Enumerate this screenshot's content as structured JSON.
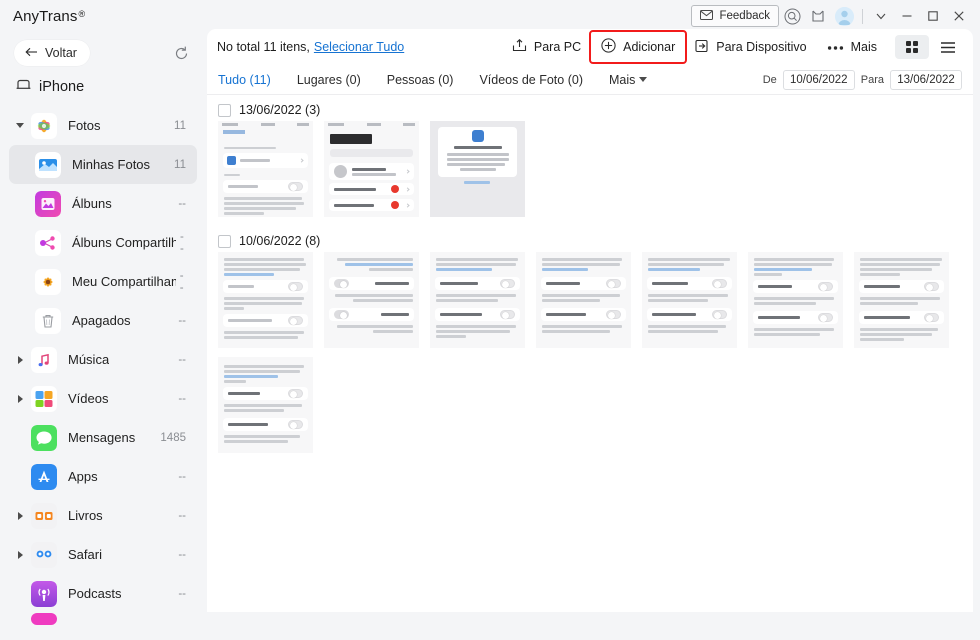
{
  "titlebar": {
    "brand": "AnyTrans",
    "registered": "®",
    "feedback_label": "Feedback",
    "icons": [
      "search-icon",
      "gift-icon",
      "account-avatar"
    ],
    "window_controls": [
      "chevron-down-icon",
      "minimize-icon",
      "maximize-icon",
      "close-icon"
    ]
  },
  "sidebar": {
    "back_label": "Voltar",
    "refresh_name": "refresh-icon",
    "device_name": "iPhone",
    "items": [
      {
        "label": "Fotos",
        "count": "11",
        "level": 1,
        "twisty": "down",
        "selected": false,
        "icon": "photos-icon"
      },
      {
        "label": "Minhas Fotos",
        "count": "11",
        "level": 2,
        "twisty": "none",
        "selected": true,
        "icon": "my-photos-icon"
      },
      {
        "label": "Álbuns",
        "count": "--",
        "level": 2,
        "twisty": "none",
        "selected": false,
        "icon": "albums-icon"
      },
      {
        "label": "Álbuns Compartilhad...",
        "count": "--",
        "level": 2,
        "twisty": "none",
        "selected": false,
        "icon": "shared-albums-icon"
      },
      {
        "label": "Meu Compartilhame...",
        "count": "--",
        "level": 2,
        "twisty": "none",
        "selected": false,
        "icon": "my-sharing-icon"
      },
      {
        "label": "Apagados",
        "count": "--",
        "level": 2,
        "twisty": "none",
        "selected": false,
        "icon": "trash-icon"
      },
      {
        "label": "Música",
        "count": "--",
        "level": 1,
        "twisty": "right",
        "selected": false,
        "icon": "music-icon"
      },
      {
        "label": "Vídeos",
        "count": "--",
        "level": 1,
        "twisty": "right",
        "selected": false,
        "icon": "videos-icon"
      },
      {
        "label": "Mensagens",
        "count": "1485",
        "level": 1,
        "twisty": "none",
        "selected": false,
        "icon": "messages-icon"
      },
      {
        "label": "Apps",
        "count": "--",
        "level": 1,
        "twisty": "none",
        "selected": false,
        "icon": "appstore-icon"
      },
      {
        "label": "Livros",
        "count": "--",
        "level": 1,
        "twisty": "right",
        "selected": false,
        "icon": "books-icon"
      },
      {
        "label": "Safari",
        "count": "--",
        "level": 1,
        "twisty": "right",
        "selected": false,
        "icon": "safari-icon"
      },
      {
        "label": "Podcasts",
        "count": "--",
        "level": 1,
        "twisty": "none",
        "selected": false,
        "icon": "podcasts-icon"
      }
    ]
  },
  "toolbar": {
    "count_text": "No total 11 itens,",
    "select_all_label": "Selecionar Tudo",
    "actions": [
      {
        "label": "Para PC",
        "icon": "export-to-pc-icon",
        "highlighted": false
      },
      {
        "label": "Adicionar",
        "icon": "plus-circle-icon",
        "highlighted": true
      },
      {
        "label": "Para Dispositivo",
        "icon": "to-device-icon",
        "highlighted": false
      },
      {
        "label": "Mais",
        "icon": "more-dots-icon",
        "highlighted": false
      }
    ],
    "view_modes": [
      {
        "name": "grid-view-button",
        "active": true
      },
      {
        "name": "list-view-button",
        "active": false
      }
    ]
  },
  "filters": {
    "tabs": [
      {
        "label": "Tudo (11)",
        "active": true
      },
      {
        "label": "Lugares (0)",
        "active": false
      },
      {
        "label": "Pessoas (0)",
        "active": false
      },
      {
        "label": "Vídeos de Foto (0)",
        "active": false
      }
    ],
    "more_label": "Mais",
    "date_from_label": "De",
    "date_from_value": "10/06/2022",
    "date_to_label": "Para",
    "date_to_value": "13/06/2022"
  },
  "groups": [
    {
      "title": "13/06/2022 (3)",
      "checked": false,
      "count": 3
    },
    {
      "title": "10/06/2022 (8)",
      "checked": false,
      "count": 8
    }
  ],
  "colors": {
    "accent_blue": "#1673d2",
    "highlight_red": "#f21b1b",
    "sidebar_bg": "#f4f5f7",
    "panel_bg": "#ffffff",
    "selected_row": "#e6e7ea"
  }
}
